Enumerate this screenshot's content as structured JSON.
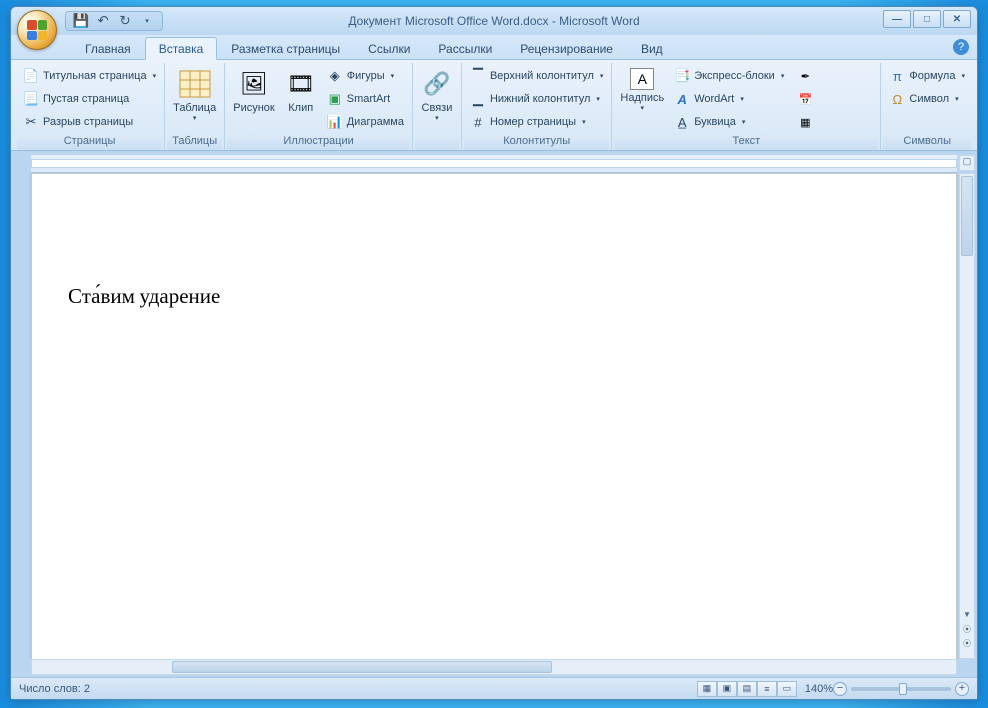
{
  "title": "Документ Microsoft Office Word.docx - Microsoft Word",
  "tabs": {
    "home": "Главная",
    "insert": "Вставка",
    "pagelayout": "Разметка страницы",
    "references": "Ссылки",
    "mailings": "Рассылки",
    "review": "Рецензирование",
    "view": "Вид"
  },
  "active_tab": "insert",
  "ribbon": {
    "pages": {
      "label": "Страницы",
      "cover": "Титульная страница",
      "blank": "Пустая страница",
      "break": "Разрыв страницы"
    },
    "tables": {
      "label": "Таблицы",
      "table": "Таблица"
    },
    "illustrations": {
      "label": "Иллюстрации",
      "picture": "Рисунок",
      "clip": "Клип",
      "shapes": "Фигуры",
      "smartart": "SmartArt",
      "chart": "Диаграмма"
    },
    "links": {
      "label": "Связи",
      "links": "Связи"
    },
    "headerfooter": {
      "label": "Колонтитулы",
      "header": "Верхний колонтитул",
      "footer": "Нижний колонтитул",
      "pagenum": "Номер страницы"
    },
    "text": {
      "label": "Текст",
      "textbox": "Надпись",
      "quickparts": "Экспресс-блоки",
      "wordart": "WordArt",
      "dropcap": "Буквица"
    },
    "symbols": {
      "label": "Символы",
      "equation": "Формула",
      "symbol": "Символ"
    }
  },
  "document": {
    "body": "Ста́вим ударение"
  },
  "statusbar": {
    "wordcount_label": "Число слов:",
    "wordcount": "2",
    "zoom": "140%"
  }
}
